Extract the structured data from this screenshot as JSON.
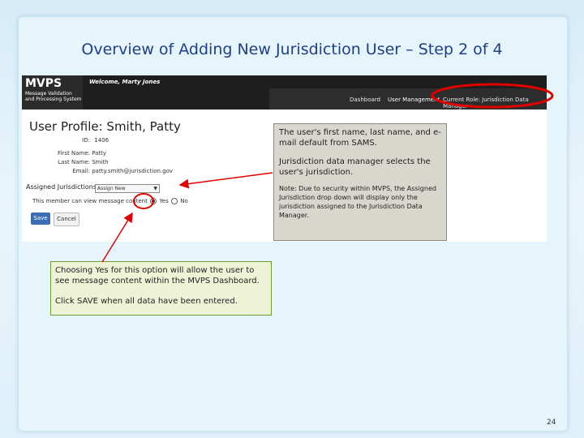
{
  "slide": {
    "title": "Overview of Adding New Jurisdiction User – Step 2 of 4",
    "page_number": "24"
  },
  "app": {
    "logo": "MVPS",
    "logo_sub": "Message Validation and Processing System",
    "welcome": "Welcome, Marty Jones",
    "nav": {
      "dashboard": "Dashboard",
      "user_management": "User Management",
      "current_role": "Current Role: Jurisdiction Data Manager ▾"
    }
  },
  "profile": {
    "title": "User Profile: Smith, Patty",
    "id_label": "ID:",
    "id_value": "1406",
    "first_name_label": "First Name:",
    "first_name_value": "Patty",
    "last_name_label": "Last Name:",
    "last_name_value": "Smith",
    "email_label": "Email:",
    "email_value": "patty.smith@jurisdiction.gov",
    "assigned_label": "Assigned Jurisdictions",
    "assigned_value": "Assign New",
    "member_text": "This member can view message content",
    "yes_label": "Yes",
    "no_label": "No",
    "save_label": "Save",
    "cancel_label": "Cancel"
  },
  "callouts": {
    "right_p1": "The user's first name, last name, and e-mail default from SAMS.",
    "right_p2": "Jurisdiction data manager selects the user's jurisdiction.",
    "right_p3": "Note: Due to security within MVPS, the Assigned Jurisdiction drop down will display only the jurisdiction assigned to the Jurisdiction Data Manager.",
    "left_p1": "Choosing Yes for this option will allow the user to see message content within the MVPS Dashboard.",
    "left_p2": "Click SAVE when all data have been entered."
  },
  "colors": {
    "title": "#1f3f8a",
    "highlight": "#e00000",
    "save_button": "#3a6fb3"
  }
}
